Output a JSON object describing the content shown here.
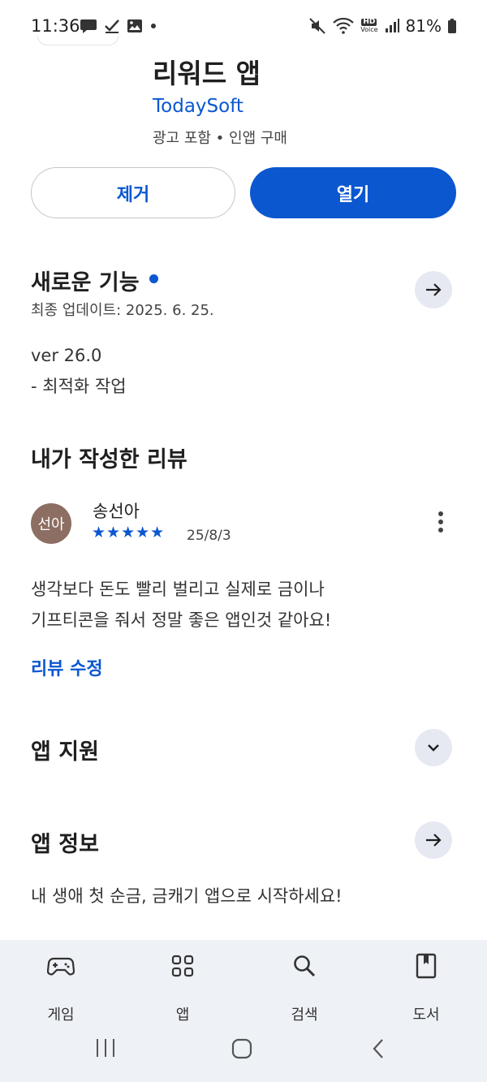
{
  "status_bar": {
    "time": "11:36",
    "battery": "81%",
    "hd_label_top": "HD",
    "hd_label_bottom": "Voice"
  },
  "app": {
    "title": "리워드 앱",
    "developer": "TodaySoft",
    "meta": "광고 포함 • 인앱 구매"
  },
  "actions": {
    "remove_label": "제거",
    "open_label": "열기"
  },
  "whats_new": {
    "title": "새로운 기능",
    "updated": "최종 업데이트: 2025. 6. 25.",
    "version": "ver 26.0",
    "notes": "- 최적화 작업"
  },
  "my_review": {
    "section_title": "내가 작성한 리뷰",
    "avatar_text": "선아",
    "author": "송선아",
    "rating": 5,
    "stars": "★★★★★",
    "date": "25/8/3",
    "text_line1": "생각보다 돈도 빨리 벌리고 실제로 금이나",
    "text_line2": "기프티콘을 줘서 정말 좋은 앱인것 같아요!",
    "edit_link": "리뷰 수정"
  },
  "app_support": {
    "title": "앱 지원"
  },
  "app_info": {
    "title": "앱 정보",
    "description": "내 생애 첫 순금, 금캐기 앱으로 시작하세요!"
  },
  "bottom_nav": {
    "items": [
      {
        "label": "게임",
        "icon": "gamepad-icon"
      },
      {
        "label": "앱",
        "icon": "apps-grid-icon"
      },
      {
        "label": "검색",
        "icon": "search-icon"
      },
      {
        "label": "도서",
        "icon": "book-icon"
      }
    ]
  },
  "colors": {
    "accent": "#0b57d0",
    "arrow_button_bg": "#e6e9f2",
    "nav_bg": "#eef1f6",
    "avatar_bg": "#8d6e63"
  }
}
